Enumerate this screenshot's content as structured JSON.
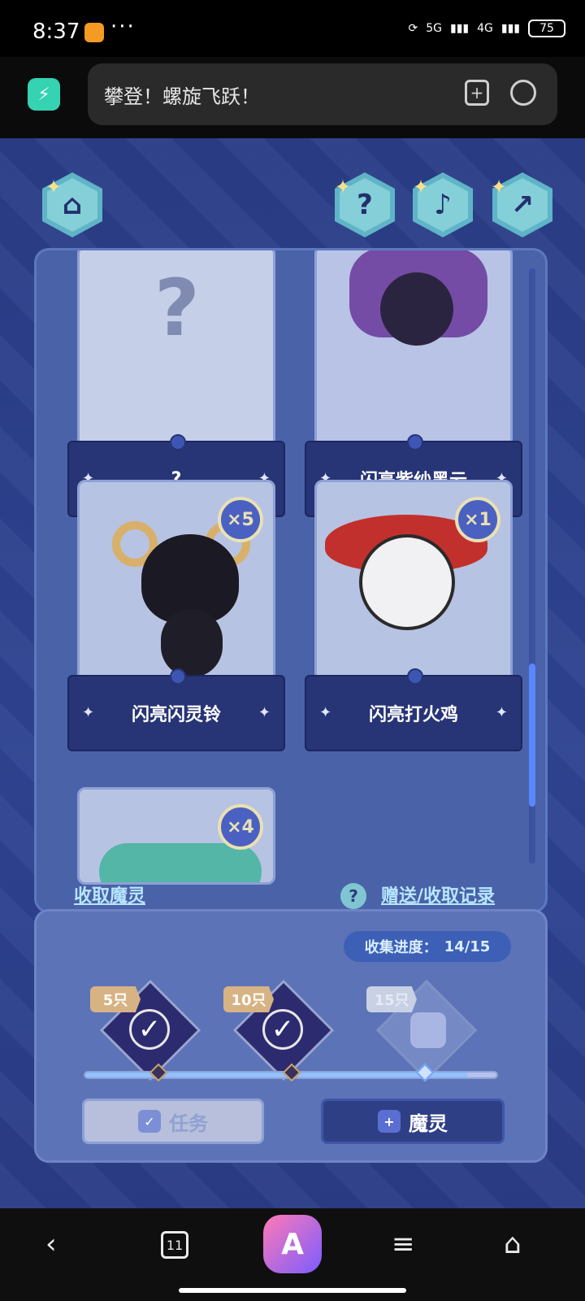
{
  "statusbar": {
    "time": "8:37",
    "more": "···",
    "net1": "5G",
    "net2": "4G",
    "battery": "75"
  },
  "browser": {
    "title": "攀登！螺旋飞跃！"
  },
  "game": {
    "top_buttons": [
      "home",
      "help",
      "music",
      "share"
    ],
    "cards": [
      {
        "name": "?",
        "count": ""
      },
      {
        "name": "闪亮紫纱黑云",
        "count": ""
      },
      {
        "name": "闪亮闪灵铃",
        "count": "×5"
      },
      {
        "name": "闪亮打火鸡",
        "count": "×1"
      },
      {
        "name": "",
        "count": "×4"
      }
    ],
    "links": {
      "collect": "收取魔灵",
      "records": "赠送/收取记录"
    },
    "progress": {
      "label": "收集进度：",
      "value": "14/15",
      "milestones": [
        "5只",
        "10只",
        "15只"
      ],
      "fraction": 0.93
    },
    "actions": {
      "task": "任务",
      "spirit": "魔灵"
    }
  },
  "navbar": {
    "tabs_count": "11"
  }
}
